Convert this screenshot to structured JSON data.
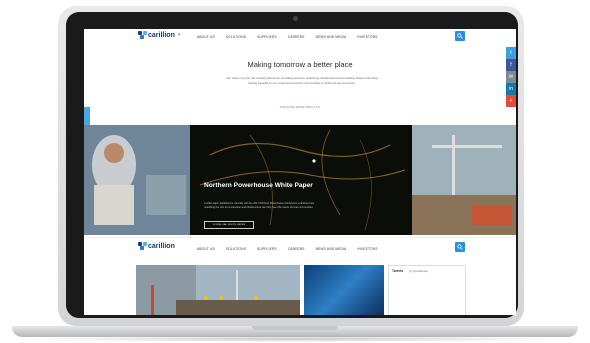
{
  "nav": {
    "logo_text": "carillion",
    "links": [
      "ABOUT US",
      "SOLUTIONS",
      "SUPPLIERS",
      "CAREERS",
      "NEWS AND MEDIA",
      "INVESTORS"
    ]
  },
  "intro": {
    "title": "Making tomorrow a better place",
    "body": "Our vision is to be the trusted partner for providing services, delivering infrastructure and creating places that bring lasting benefits to our customers and the communities in which we live and work.",
    "link": "DISCOVER MORE ABOUT US"
  },
  "hero": {
    "title": "Northern Powerhouse White Paper",
    "body": "A white paper published to coincide with the 2017 Northern Powerhouse Conference examines how redefining the role of construction and infrastructure can help meet the needs of local communities.",
    "button": "DOWNLOAD WHITE PAPER"
  },
  "social": [
    {
      "icon": "twitter-icon",
      "glyph": "t",
      "color": "#3aa0e0"
    },
    {
      "icon": "facebook-icon",
      "glyph": "f",
      "color": "#3b5998"
    },
    {
      "icon": "email-icon",
      "glyph": "✉",
      "color": "#7a8a99"
    },
    {
      "icon": "linkedin-icon",
      "glyph": "in",
      "color": "#1278a8"
    },
    {
      "icon": "plus-icon",
      "glyph": "+",
      "color": "#e24b3b"
    }
  ],
  "tweets": {
    "heading": "Tweets",
    "by": "by @Carillionplc"
  },
  "colors": {
    "accent": "#2d8fe0",
    "brand": "#1a3c7a"
  }
}
